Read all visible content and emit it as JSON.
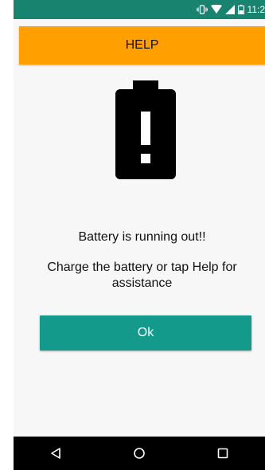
{
  "status_bar": {
    "time": "11:2",
    "icons": [
      "vibrate-icon",
      "wifi-icon",
      "signal-icon",
      "battery-status-icon"
    ]
  },
  "header": {
    "help_label": "HELP"
  },
  "main": {
    "icon": "battery-alert-icon",
    "title": "Battery is running out!!",
    "body": "Charge the battery or tap Help for assistance",
    "ok_label": "Ok"
  },
  "nav": {
    "buttons": [
      "back-icon",
      "home-icon",
      "recents-icon"
    ]
  },
  "colors": {
    "status_bar": "#18846f",
    "help_button": "#ffa000",
    "ok_button": "#139a8a",
    "nav_bar": "#000000"
  }
}
